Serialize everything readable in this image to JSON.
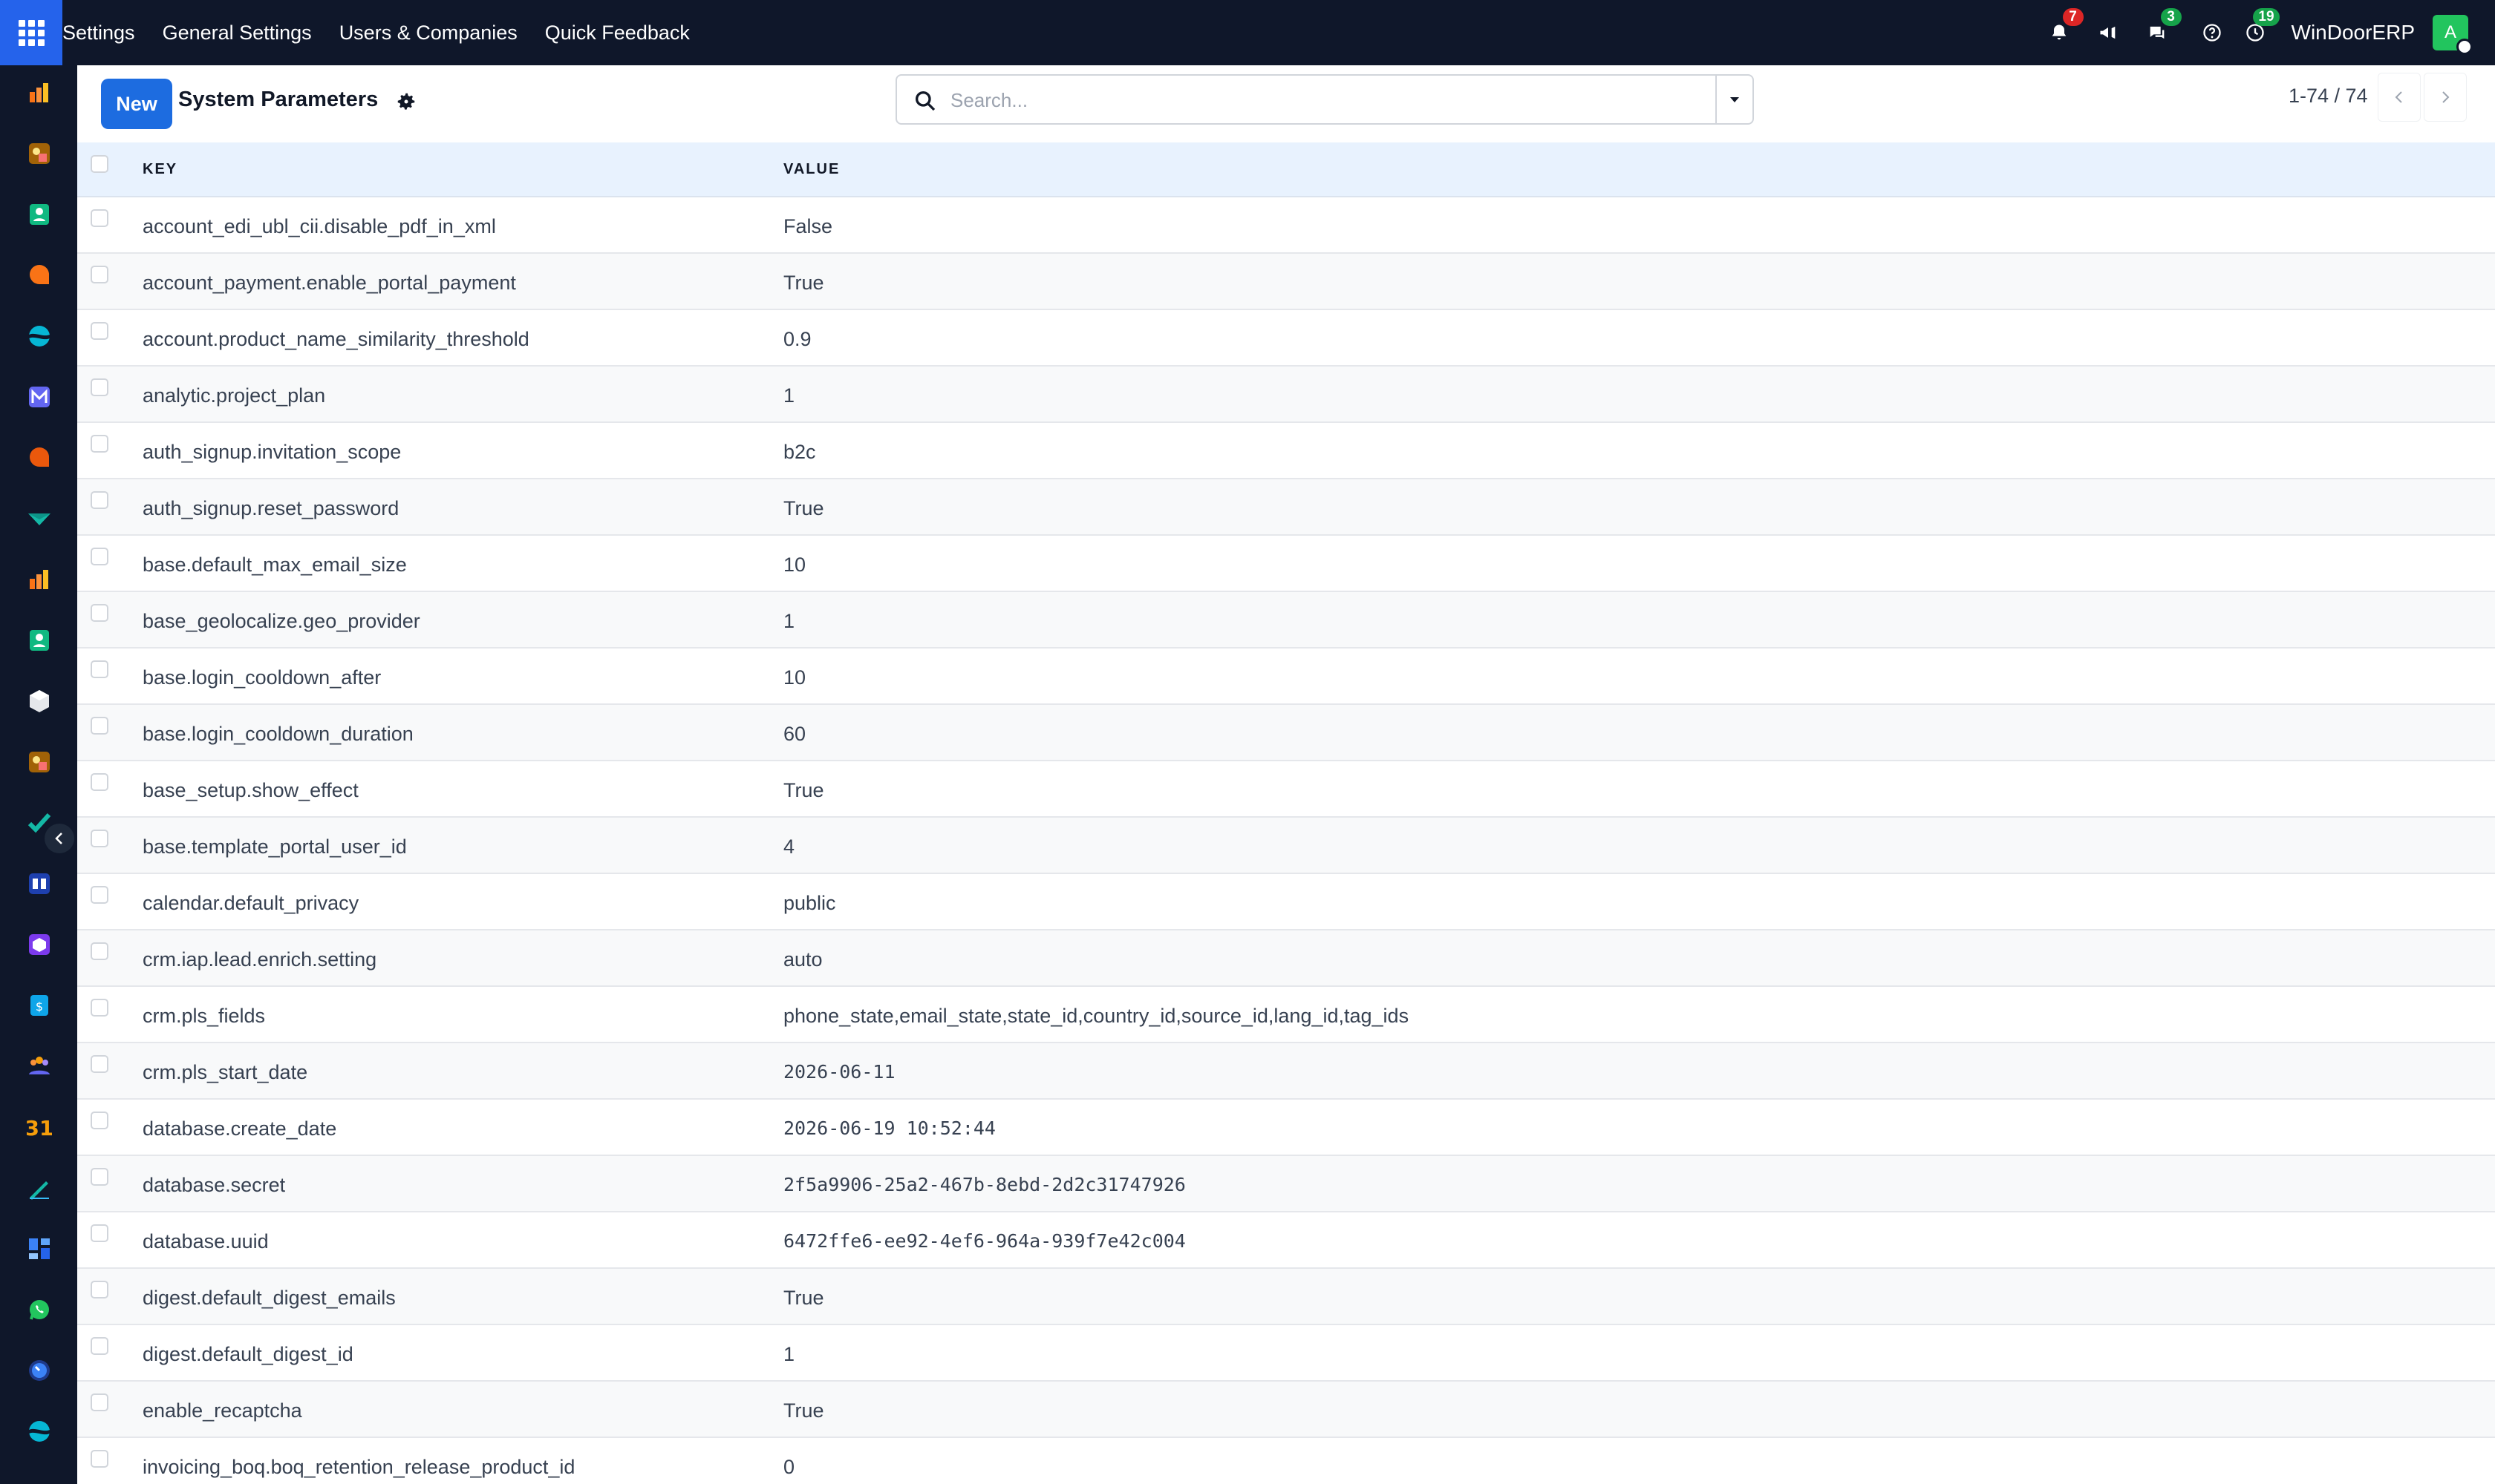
{
  "topbar": {
    "menu": [
      "Settings",
      "General Settings",
      "Users & Companies",
      "Quick Feedback"
    ],
    "notifications_count": "7",
    "messages_count": "3",
    "activities_count": "19",
    "company": "WinDoorERP",
    "avatar_initial": "A"
  },
  "control": {
    "new_label": "New",
    "title": "System Parameters",
    "search_placeholder": "Search...",
    "pager": "1-74 / 74"
  },
  "table": {
    "columns": [
      "KEY",
      "VALUE"
    ],
    "rows": [
      {
        "key": "account_edi_ubl_cii.disable_pdf_in_xml",
        "value": "False"
      },
      {
        "key": "account_payment.enable_portal_payment",
        "value": "True"
      },
      {
        "key": "account.product_name_similarity_threshold",
        "value": "0.9"
      },
      {
        "key": "analytic.project_plan",
        "value": "1"
      },
      {
        "key": "auth_signup.invitation_scope",
        "value": "b2c"
      },
      {
        "key": "auth_signup.reset_password",
        "value": "True"
      },
      {
        "key": "base.default_max_email_size",
        "value": "10"
      },
      {
        "key": "base_geolocalize.geo_provider",
        "value": "1"
      },
      {
        "key": "base.login_cooldown_after",
        "value": "10"
      },
      {
        "key": "base.login_cooldown_duration",
        "value": "60"
      },
      {
        "key": "base_setup.show_effect",
        "value": "True"
      },
      {
        "key": "base.template_portal_user_id",
        "value": "4"
      },
      {
        "key": "calendar.default_privacy",
        "value": "public"
      },
      {
        "key": "crm.iap.lead.enrich.setting",
        "value": "auto"
      },
      {
        "key": "crm.pls_fields",
        "value": "phone_state,email_state,state_id,country_id,source_id,lang_id,tag_ids"
      },
      {
        "key": "crm.pls_start_date",
        "value": "2026-06-11",
        "mono": true
      },
      {
        "key": "database.create_date",
        "value": "2026-06-19 10:52:44",
        "mono": true
      },
      {
        "key": "database.secret",
        "value": "2f5a9906-25a2-467b-8ebd-2d2c31747926",
        "mono": true
      },
      {
        "key": "database.uuid",
        "value": "6472ffe6-ee92-4ef6-964a-939f7e42c004",
        "mono": true
      },
      {
        "key": "digest.default_digest_emails",
        "value": "True"
      },
      {
        "key": "digest.default_digest_id",
        "value": "1"
      },
      {
        "key": "enable_recaptcha",
        "value": "True"
      },
      {
        "key": "invoicing_boq.boq_retention_release_product_id",
        "value": "0"
      }
    ]
  },
  "sidebar": {
    "apps": [
      "reporting-icon",
      "studio-icon",
      "contacts-icon",
      "discuss-icon",
      "website-icon",
      "email-marketing-icon",
      "livechat-icon",
      "project-icon",
      "reporting-icon",
      "employees-icon",
      "inventory-icon",
      "studio-icon",
      "todo-icon",
      "knowledge-icon",
      "apps-icon",
      "expenses-icon",
      "team-icon",
      "calendar-icon",
      "sign-icon",
      "dashboards-icon",
      "whatsapp-icon",
      "timer-icon",
      "website-icon"
    ]
  },
  "colors": {
    "navbar": "#0f172a",
    "accent": "#1d6ce0",
    "header_row": "#e8f2fe"
  }
}
